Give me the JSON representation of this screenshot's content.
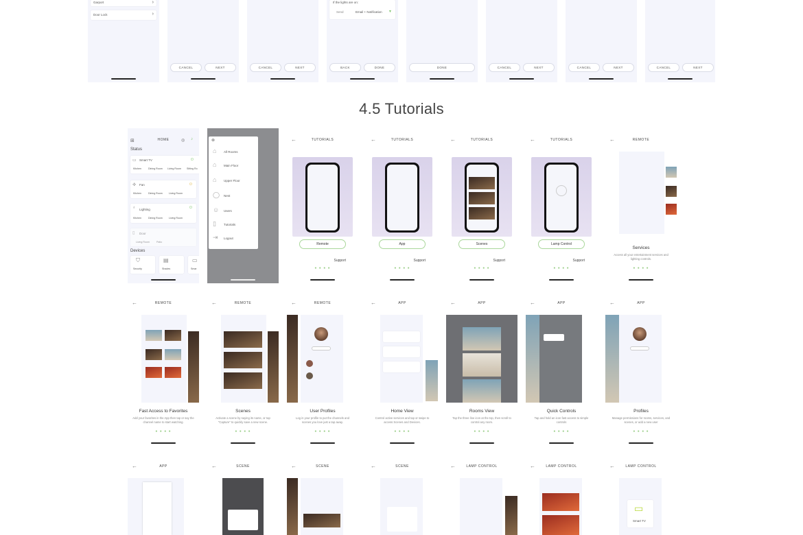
{
  "section_title": "4.5 Tutorials",
  "top_row": {
    "first_screen": {
      "items": [
        "Garport",
        "Door Lock"
      ]
    },
    "lights_card": {
      "question": "If the lights are on:",
      "label": "Send",
      "value": "Email + Notification"
    },
    "buttons": {
      "cancel": "CANCEL",
      "next": "NEXT",
      "back": "BACK",
      "done": "DONE"
    }
  },
  "home_screen": {
    "title": "HOME",
    "status_label": "Status",
    "devices_label": "Devices",
    "items": [
      {
        "name": "Smart TV",
        "rooms": [
          "Kitchen",
          "Dining Room",
          "Living Room",
          "Sitting Ro"
        ]
      },
      {
        "name": "Fan",
        "rooms": [
          "Kitchen",
          "Dining Room",
          "Living Room"
        ]
      },
      {
        "name": "Lighting",
        "rooms": [
          "Kitchen",
          "Dining Room",
          "Living Room"
        ]
      },
      {
        "name": "Door",
        "rooms": [
          "Living Room",
          "Patio"
        ]
      }
    ],
    "device_tiles": [
      "Security",
      "Shades",
      "Smar"
    ]
  },
  "menu_screen": {
    "items": [
      "All Rooms",
      "Main Floor",
      "Upper Floor",
      "Nest",
      "Users",
      "Tutorials",
      "Logout"
    ]
  },
  "tutorial_screens": [
    {
      "header": "TUTORIALS",
      "button": "Remote",
      "support": "Support",
      "dots": "● ● ● ●"
    },
    {
      "header": "TUTORIALS",
      "button": "App",
      "support": "Support",
      "dots": "● ● ● ●"
    },
    {
      "header": "TUTORIALS",
      "button": "Scenes",
      "support": "Support",
      "dots": "● ● ● ●"
    },
    {
      "header": "TUTORIALS",
      "button": "Lamp Control",
      "support": "Support",
      "dots": "● ● ● ●"
    }
  ],
  "services_screen": {
    "header": "REMOTE",
    "title": "Services",
    "desc": "Access all your entertainment services and lighting controls.",
    "dots": "● ● ● ●"
  },
  "row2": [
    {
      "header": "REMOTE",
      "title": "Fast Access to Favorites",
      "desc": "Add your favorites in the App then tap or say the channel name to start watching.",
      "dots": "● ● ● ●"
    },
    {
      "header": "REMOTE",
      "title": "Scenes",
      "desc": "Activate a scene by saying its name, or tap \"Capture\" to quickly save a new scene.",
      "dots": "● ● ● ●"
    },
    {
      "header": "REMOTE",
      "title": "User Profiles",
      "desc": "Log in your profile to put the channels and scenes you love just a tap away.",
      "dots": "● ● ● ●"
    },
    {
      "header": "APP",
      "title": "Home View",
      "desc": "Control active services and tap or swipe to access Scenes and Devices.",
      "dots": "● ● ● ●"
    },
    {
      "header": "APP",
      "title": "Rooms View",
      "desc": "Tap the three line icon at the top, then scroll to control any room.",
      "dots": "● ● ● ●"
    },
    {
      "header": "APP",
      "title": "Quick Controls",
      "desc": "Tap and hold an icon fast access to simple controls",
      "dots": "● ● ● ●"
    },
    {
      "header": "APP",
      "title": "Profiles",
      "desc": "Manage permissions for rooms, services, and scenes, or add a new user",
      "dots": "● ● ● ●"
    }
  ],
  "row3": [
    {
      "header": "APP"
    },
    {
      "header": "SCENE"
    },
    {
      "header": "SCENE"
    },
    {
      "header": "SCENE"
    },
    {
      "header": "LAMP CONTROL"
    },
    {
      "header": "LAMP CONTROL"
    },
    {
      "header": "LAMP CONTROL",
      "tile": "Smart TV"
    }
  ],
  "colors": {
    "accent_green": "#a9d79a",
    "screen_bg": "#f4f5fc",
    "tutorial_band": "#d9d2ea"
  }
}
